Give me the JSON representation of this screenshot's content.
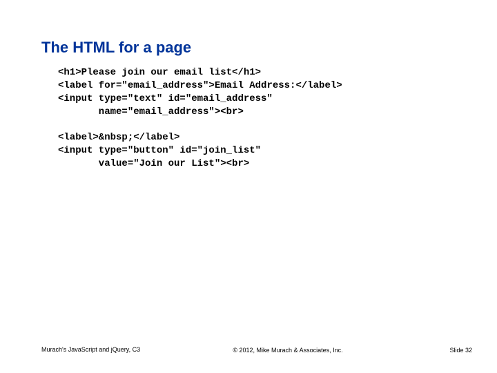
{
  "title": "The HTML for a page",
  "code": "<h1>Please join our email list</h1>\n<label for=\"email_address\">Email Address:</label>\n<input type=\"text\" id=\"email_address\"\n       name=\"email_address\"><br>\n\n<label>&nbsp;</label>\n<input type=\"button\" id=\"join_list\"\n       value=\"Join our List\"><br>",
  "footer": {
    "left": "Murach's JavaScript and jQuery, C3",
    "center": "© 2012, Mike Murach & Associates, Inc.",
    "right": "Slide 32"
  }
}
